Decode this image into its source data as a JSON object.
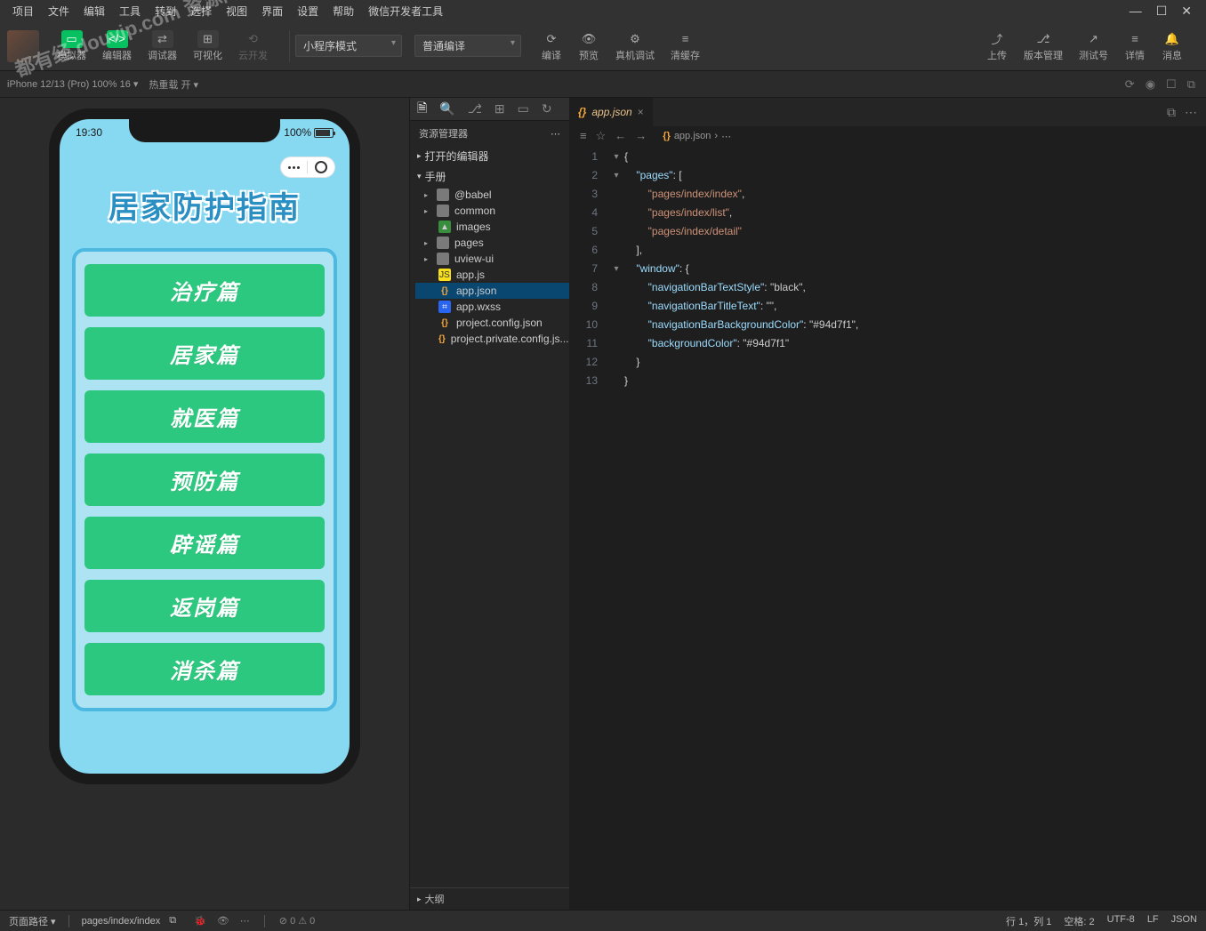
{
  "menus": [
    "项目",
    "文件",
    "编辑",
    "工具",
    "转到",
    "选择",
    "视图",
    "界面",
    "设置",
    "帮助",
    "微信开发者工具"
  ],
  "toolbar": {
    "simulator": "模拟器",
    "editor": "编辑器",
    "debugger": "调试器",
    "visual": "可视化",
    "cloud": "云开发",
    "mode": "小程序模式",
    "compileMode": "普通编译",
    "compile": "编译",
    "preview": "预览",
    "realDevice": "真机调试",
    "clearCache": "清缓存",
    "upload": "上传",
    "version": "版本管理",
    "test": "测试号",
    "detail": "详情",
    "message": "消息"
  },
  "subbar": {
    "device": "iPhone 12/13 (Pro) 100% 16 ▾",
    "hotReload": "热重载 开 ▾"
  },
  "sim": {
    "time": "19:30",
    "battery": "100%",
    "title": "居家防护指南",
    "chapters": [
      "治疗篇",
      "居家篇",
      "就医篇",
      "预防篇",
      "辟谣篇",
      "返岗篇",
      "消杀篇"
    ]
  },
  "explorer": {
    "title": "资源管理器",
    "openEditors": "打开的编辑器",
    "project": "手册",
    "items": [
      {
        "name": "@babel",
        "type": "folder"
      },
      {
        "name": "common",
        "type": "folder"
      },
      {
        "name": "images",
        "type": "img"
      },
      {
        "name": "pages",
        "type": "folder-blue"
      },
      {
        "name": "uview-ui",
        "type": "folder"
      },
      {
        "name": "app.js",
        "type": "js"
      },
      {
        "name": "app.json",
        "type": "json",
        "selected": true
      },
      {
        "name": "app.wxss",
        "type": "wxss"
      },
      {
        "name": "project.config.json",
        "type": "json"
      },
      {
        "name": "project.private.config.js...",
        "type": "json"
      }
    ],
    "outline": "大纲"
  },
  "editor": {
    "tabName": "app.json",
    "breadcrumb": "app.json",
    "lines": [
      "{",
      "  \"pages\": [",
      "    \"pages/index/index\",",
      "    \"pages/index/list\",",
      "    \"pages/index/detail\"",
      "  ],",
      "  \"window\": {",
      "    \"navigationBarTextStyle\": \"black\",",
      "    \"navigationBarTitleText\": \"\",",
      "    \"navigationBarBackgroundColor\": \"#94d7f1\",",
      "    \"backgroundColor\": \"#94d7f1\"",
      "  }",
      "}"
    ],
    "folds": {
      "1": "▾",
      "2": "▾",
      "7": "▾"
    }
  },
  "status": {
    "pagePathLabel": "页面路径 ▾",
    "pagePath": "pages/index/index",
    "errWarn": "⊘ 0 ⚠ 0",
    "pos": "行 1，列 1",
    "spaces": "空格: 2",
    "encoding": "UTF-8",
    "eol": "LF",
    "lang": "JSON"
  },
  "watermark": "都有经 douvip.com 资源网"
}
